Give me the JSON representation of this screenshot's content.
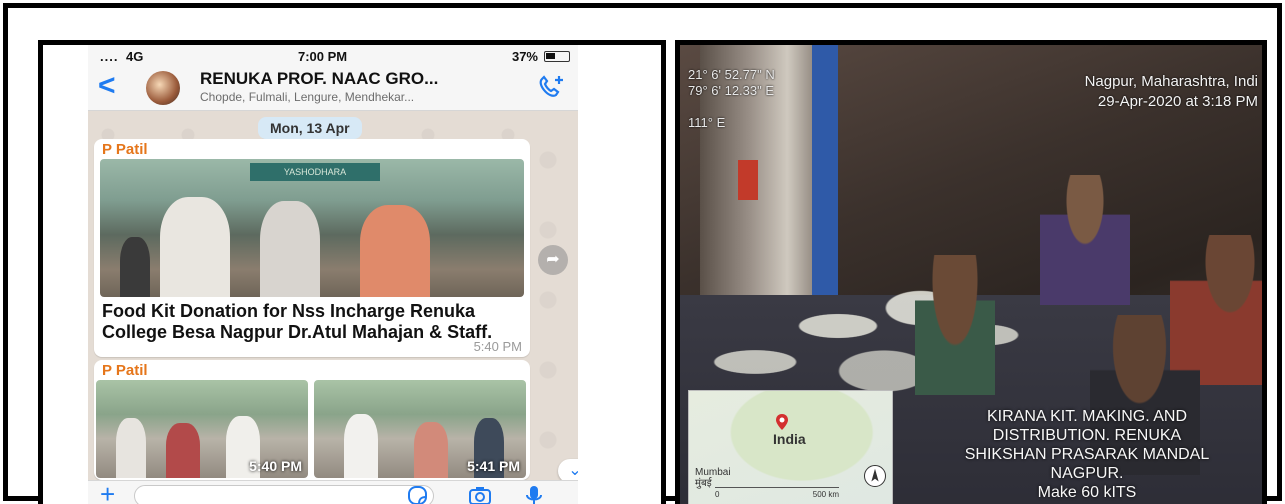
{
  "whatsapp": {
    "status": {
      "signal": "....",
      "network": "4G",
      "time": "7:00 PM",
      "battery": "37%"
    },
    "chat": {
      "back": "<",
      "title": "RENUKA PROF. NAAC GRO...",
      "subtitle": "Chopde, Fulmali, Lengure, Mendhekar..."
    },
    "date_chip": "Mon, 13 Apr",
    "messages": [
      {
        "sender": "P Patil",
        "photo_sign": "YASHODHARA",
        "caption": "Food Kit Donation for Nss Incharge Renuka College Besa Nagpur Dr.Atul Mahajan & Staff.",
        "time": "5:40 PM"
      },
      {
        "sender": "P Patil",
        "photo_times": [
          "5:40 PM",
          "5:41 PM"
        ]
      }
    ],
    "composer": {
      "plus": "+"
    },
    "colors": {
      "accent": "#1f7bf0",
      "sender": "#e5761b"
    }
  },
  "geotag": {
    "lat": "21° 6' 52.77\" N",
    "lon": "79° 6' 12.33\" E",
    "heading": "111° E",
    "place": "Nagpur, Maharashtra, Indi",
    "datetime": "29-Apr-2020 at 3:18 PM",
    "map": {
      "country": "India",
      "city_en": "Mumbai",
      "city_local": "मुंबई",
      "scale_start": "0",
      "scale_end": "500 km"
    },
    "overlay": [
      "KIRANA KIT.   MAKING.   AND",
      "DISTRIBUTION.          RENUKA",
      "SHIKSHAN PRASARAK MANDAL",
      "NAGPUR.",
      "Make 60 kITS"
    ]
  }
}
